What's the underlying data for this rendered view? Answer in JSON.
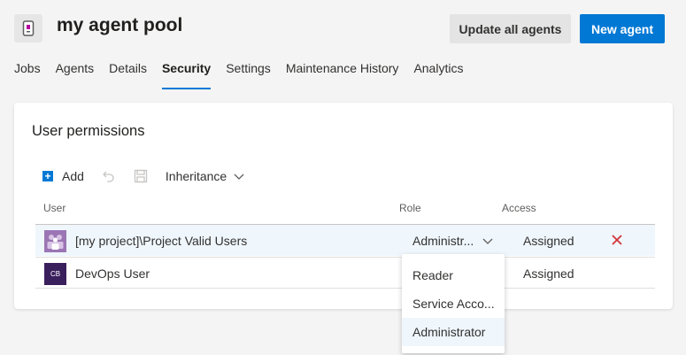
{
  "header": {
    "title": "my agent pool",
    "icon": "agent-pool-icon",
    "update_all_label": "Update all agents",
    "new_agent_label": "New agent"
  },
  "tabs": [
    {
      "label": "Jobs",
      "active": false
    },
    {
      "label": "Agents",
      "active": false
    },
    {
      "label": "Details",
      "active": false
    },
    {
      "label": "Security",
      "active": true
    },
    {
      "label": "Settings",
      "active": false
    },
    {
      "label": "Maintenance History",
      "active": false
    },
    {
      "label": "Analytics",
      "active": false
    }
  ],
  "permissions": {
    "title": "User permissions",
    "toolbar": {
      "add_label": "Add",
      "inheritance_label": "Inheritance"
    },
    "columns": {
      "user": "User",
      "role": "Role",
      "access": "Access"
    },
    "rows": [
      {
        "user": "[my project]\\Project Valid Users",
        "role": "Administr...",
        "access": "Assigned",
        "avatar": "group-icon",
        "avatar_initials": ""
      },
      {
        "user": "DevOps User",
        "role": "",
        "access": "Assigned",
        "avatar": "user-avatar",
        "avatar_initials": "CB"
      }
    ]
  },
  "role_dropdown": {
    "options": [
      {
        "label": "Reader",
        "selected": false
      },
      {
        "label": "Service Acco...",
        "selected": false
      },
      {
        "label": "Administrator",
        "selected": true
      }
    ]
  },
  "colors": {
    "accent": "#0078d4",
    "remove": "#d13438",
    "selected_row": "#eff6fc"
  }
}
